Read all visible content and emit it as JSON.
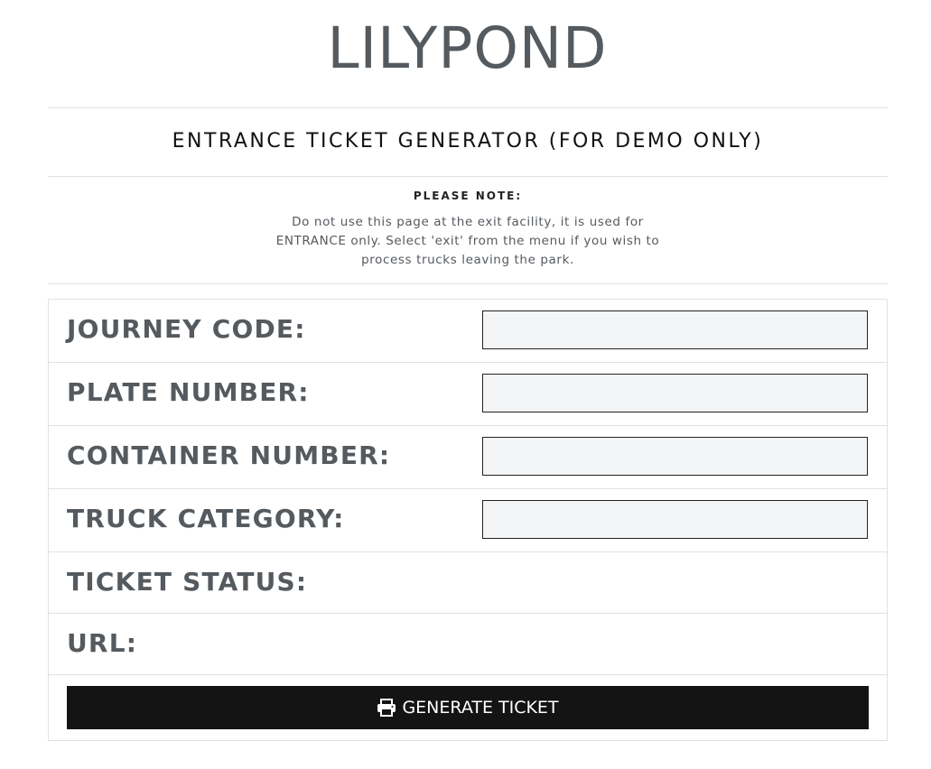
{
  "header": {
    "brand": "LILYPOND",
    "subtitle": "ENTRANCE TICKET GENERATOR (FOR DEMO ONLY)"
  },
  "note": {
    "heading": "PLEASE NOTE:",
    "body": "Do not use this page at the exit facility, it is used for ENTRANCE only. Select 'exit' from the menu if you wish to process trucks leaving the park."
  },
  "form": {
    "journey_code": {
      "label": "JOURNEY CODE:",
      "value": ""
    },
    "plate_number": {
      "label": "PLATE NUMBER:",
      "value": ""
    },
    "container_number": {
      "label": "CONTAINER NUMBER:",
      "value": ""
    },
    "truck_category": {
      "label": "TRUCK CATEGORY:",
      "value": ""
    },
    "ticket_status": {
      "label": "TICKET STATUS:",
      "value": ""
    },
    "url": {
      "label": "URL:",
      "value": ""
    }
  },
  "actions": {
    "generate_label": "GENERATE TICKET",
    "generate_icon": "printer-icon"
  }
}
